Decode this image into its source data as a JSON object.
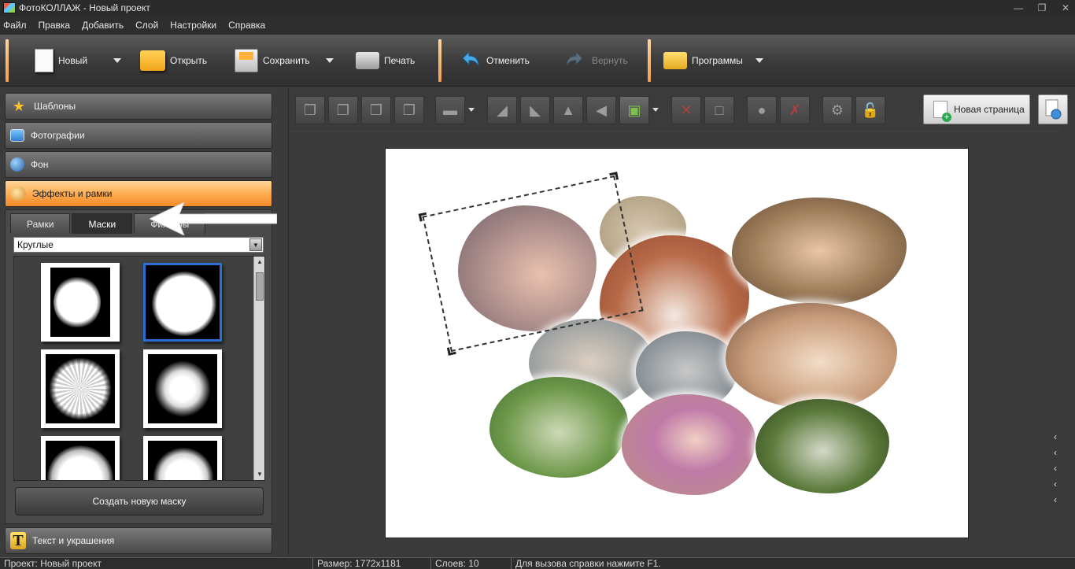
{
  "window": {
    "title": "ФотоКОЛЛАЖ - Новый проект",
    "controls": [
      "minimize-icon",
      "restore-icon",
      "close-icon"
    ]
  },
  "menu": [
    "Файл",
    "Правка",
    "Добавить",
    "Слой",
    "Настройки",
    "Справка"
  ],
  "toolbar": {
    "new_label": "Новый",
    "open_label": "Открыть",
    "save_label": "Сохранить",
    "print_label": "Печать",
    "undo_label": "Отменить",
    "redo_label": "Вернуть",
    "programs_label": "Программы"
  },
  "sidebar": {
    "items": [
      {
        "label": "Шаблоны",
        "icon": "star-icon"
      },
      {
        "label": "Фотографии",
        "icon": "photos-icon"
      },
      {
        "label": "Фон",
        "icon": "background-icon"
      },
      {
        "label": "Эффекты и рамки",
        "icon": "palette-icon",
        "active": true
      }
    ],
    "bottom_item": {
      "label": "Текст и украшения",
      "icon": "text-icon"
    },
    "tabs": [
      "Рамки",
      "Маски",
      "Фильтры"
    ],
    "active_tab": "Маски",
    "select_value": "Круглые",
    "create_mask_label": "Создать новую маску"
  },
  "edit_toolbar": {
    "new_page_label": "Новая страница"
  },
  "status": {
    "project": "Проект:  Новый проект",
    "size": "Размер:  1772x1181",
    "layers": "Слоев:  10",
    "help": "Для вызова справки нажмите F1."
  },
  "colors": {
    "accent_orange": "#ffa94d",
    "selection_blue": "#2b6fd6",
    "background": "#3a3a3a"
  }
}
